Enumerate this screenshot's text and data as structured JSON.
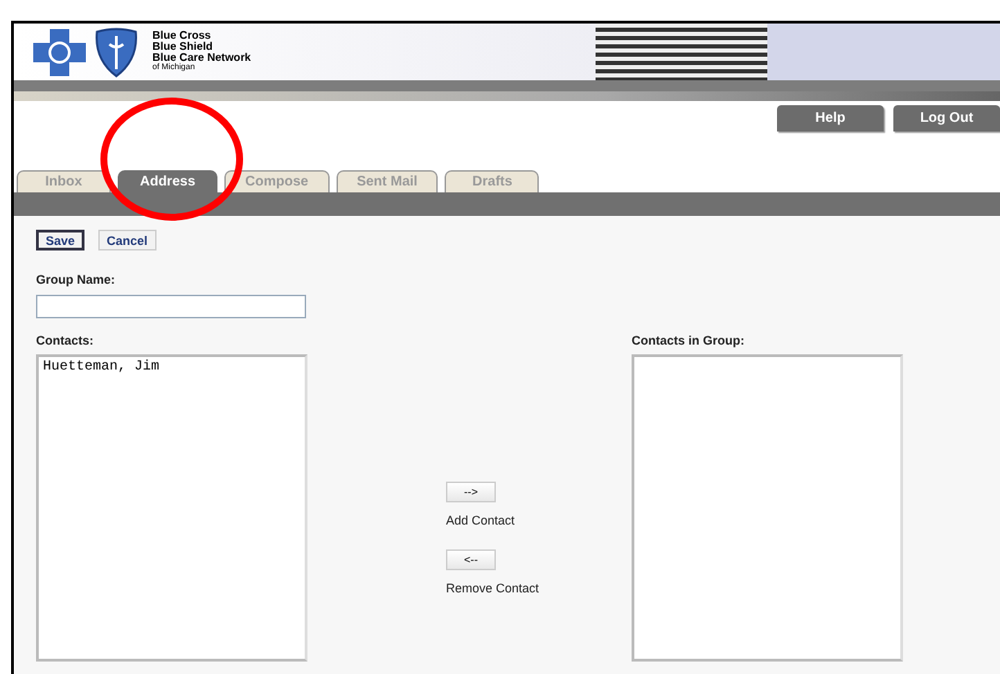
{
  "header": {
    "logo_lines": [
      "Blue Cross",
      "Blue Shield",
      "Blue Care Network",
      "of Michigan"
    ]
  },
  "top_buttons": [
    "Help",
    "Log Out"
  ],
  "tabs": [
    {
      "label": "Inbox",
      "selected": false
    },
    {
      "label": "Address",
      "selected": true
    },
    {
      "label": "Compose",
      "selected": false
    },
    {
      "label": "Sent Mail",
      "selected": false
    },
    {
      "label": "Drafts",
      "selected": false
    }
  ],
  "actions": [
    "Save",
    "Cancel"
  ],
  "group_name": {
    "label": "Group Name:"
  },
  "contacts": {
    "label": "Contacts:",
    "items": [
      "Huetteman, Jim"
    ]
  },
  "transfer": [
    {
      "button": "-->",
      "label": "Add Contact"
    },
    {
      "button": "<--",
      "label": "Remove Contact"
    }
  ],
  "group_contacts": {
    "label": "Contacts in Group:"
  }
}
